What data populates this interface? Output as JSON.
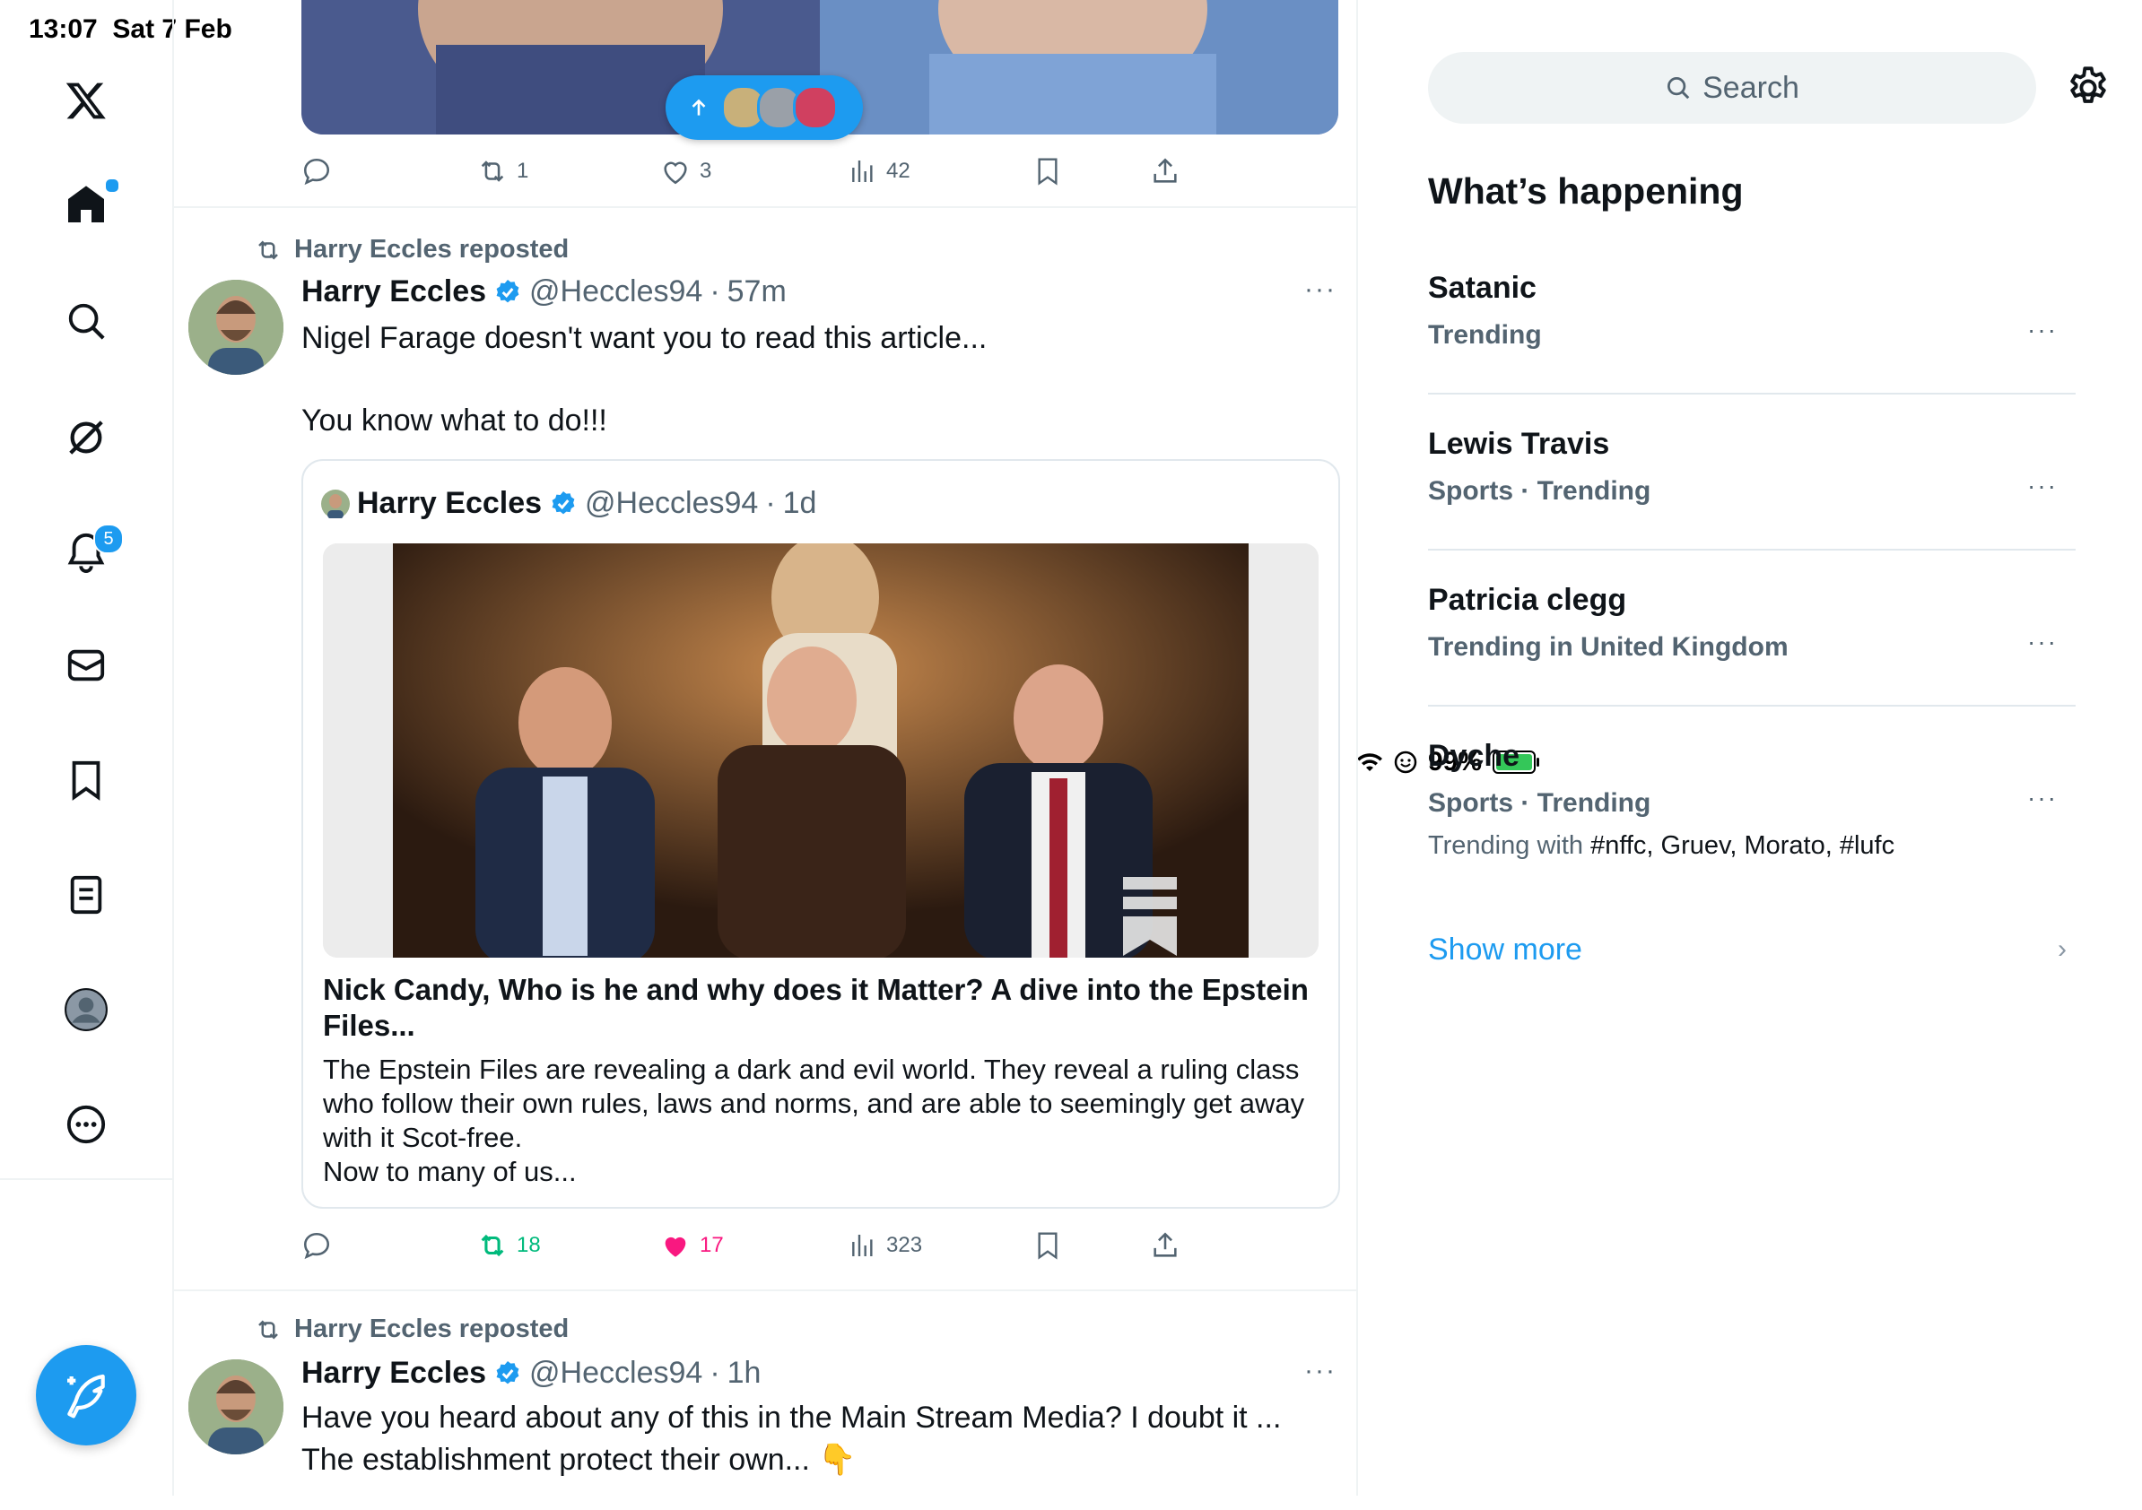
{
  "status_bar": {
    "time": "13:07",
    "date": "Sat 7 Feb",
    "battery": "99%",
    "battery_level": 0.99
  },
  "nav": {
    "items": [
      "x-logo-icon",
      "home-icon",
      "explore-icon",
      "grok-icon",
      "notifications-icon",
      "messages-icon",
      "bookmarks-icon",
      "lists-icon",
      "profile-icon",
      "more-icon"
    ],
    "notifications_badge": "5"
  },
  "timeline": {
    "top_post_actions": {
      "replies": "",
      "reposts": "1",
      "likes": "3",
      "views": "42"
    },
    "post1": {
      "reposted_by": "Harry Eccles reposted",
      "name": "Harry Eccles",
      "handle": "@Heccles94",
      "sep": "·",
      "time": "57m",
      "text_line1": "Nigel Farage doesn't want you to read this article...",
      "text_line2": "You know what to do!!!",
      "quote": {
        "name": "Harry Eccles",
        "handle": "@Heccles94",
        "sep": "·",
        "time": "1d",
        "title": "Nick Candy, Who is he and why does it Matter? A dive into the Epstein Files...",
        "desc_line1": "The Epstein Files are revealing a dark and evil world. They reveal a ruling class who follow their own rules, laws and norms, and are able to seemingly get away with it Scot-free.",
        "desc_line2": "Now to many of us..."
      },
      "actions": {
        "replies": "",
        "reposts": "18",
        "likes": "17",
        "views": "323"
      }
    },
    "post2": {
      "reposted_by": "Harry Eccles reposted",
      "name": "Harry Eccles",
      "handle": "@Heccles94",
      "sep": "·",
      "time": "1h",
      "text": "Have you heard about any of this in the Main Stream Media? I doubt it ... The establishment protect their own... 👇"
    }
  },
  "sidebar": {
    "search_placeholder": "Search",
    "heading": "What’s happening",
    "trends": [
      {
        "name": "Satanic",
        "meta": "Trending"
      },
      {
        "name": "Lewis Travis",
        "meta": "Sports · Trending"
      },
      {
        "name": "Patricia clegg",
        "meta": "Trending in United Kingdom"
      },
      {
        "name": "Dyche",
        "meta": "Sports · Trending",
        "with_label": "Trending with",
        "with_tags": "#nffc, Gruev, Morato, #lufc"
      }
    ],
    "show_more": "Show more"
  },
  "colors": {
    "accent": "#1d9bf0",
    "like": "#f91880",
    "repost": "#00ba7c",
    "muted": "#536471"
  }
}
